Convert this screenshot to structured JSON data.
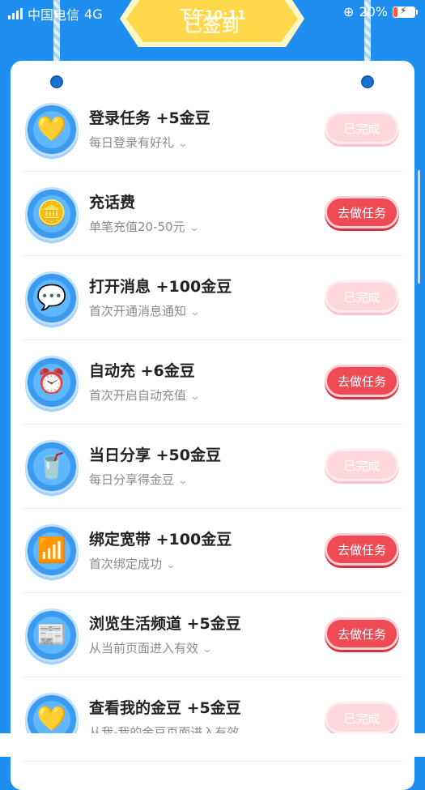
{
  "status_bar": {
    "carrier": "中国电信",
    "network": "4G",
    "time": "下午10:11",
    "battery_percent": "20%",
    "battery_level": 0.2,
    "battery_color": "#ff5a3c"
  },
  "header": {
    "signed_label": "已签到"
  },
  "colors": {
    "background": "#1e8ff0",
    "done_button": "#ffd7dc",
    "go_button": "#f04a56"
  },
  "tasks": [
    {
      "title": "登录任务 +5金豆",
      "subtitle": "每日登录有好礼",
      "button": "已完成",
      "state": "done",
      "icon": "hearts-icon",
      "glyph": "💛"
    },
    {
      "title": "充话费",
      "subtitle": "单笔充值20-50元",
      "button": "去做任务",
      "state": "todo",
      "icon": "coin-stack-icon",
      "glyph": "🪙"
    },
    {
      "title": "打开消息 +100金豆",
      "subtitle": "首次开通消息通知",
      "button": "已完成",
      "state": "done",
      "icon": "message-bubble-icon",
      "glyph": "💬"
    },
    {
      "title": "自动充 +6金豆",
      "subtitle": "首次开启自动充值",
      "button": "去做任务",
      "state": "todo",
      "icon": "alarm-clock-icon",
      "glyph": "⏰"
    },
    {
      "title": "当日分享 +50金豆",
      "subtitle": "每日分享得金豆",
      "button": "已完成",
      "state": "done",
      "icon": "drink-cup-icon",
      "glyph": "🥤"
    },
    {
      "title": "绑定宽带 +100金豆",
      "subtitle": "首次绑定成功",
      "button": "去做任务",
      "state": "todo",
      "icon": "router-icon",
      "glyph": "📶"
    },
    {
      "title": "浏览生活频道 +5金豆",
      "subtitle": "从当前页面进入有效",
      "button": "去做任务",
      "state": "todo",
      "icon": "life-channel-icon",
      "glyph": "📰"
    },
    {
      "title": "查看我的金豆 +5金豆",
      "subtitle": "从我-我的金豆页面进入有效",
      "button": "已完成",
      "state": "done",
      "icon": "hearts-icon",
      "glyph": "💛"
    }
  ]
}
